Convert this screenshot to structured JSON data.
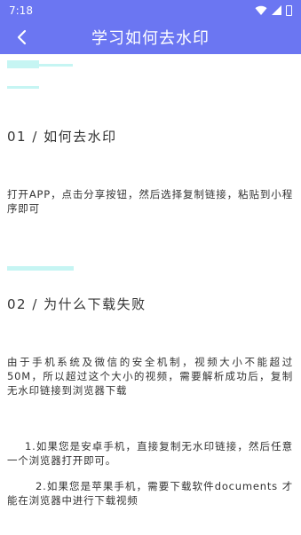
{
  "status_bar": {
    "time": "7:18"
  },
  "header": {
    "title": "学习如何去水印"
  },
  "sections": [
    {
      "heading": "01 /  如何去水印",
      "body": "打开APP，点击分享按钮，然后选择复制链接，粘贴到小程序即可"
    },
    {
      "heading": "02 /  为什么下载失败",
      "body": "由于手机系统及微信的安全机制，视频大小不能超过50M，所以超过这个大小的视频，需要解析成功后，复制无水印链接到浏览器下载",
      "tips": [
        "1.如果您是安卓手机，直接复制无水印链接，然后任意一个浏览器打开即可。",
        "2.如果您是苹果手机，需要下载软件documents 才能在浏览器中进行下载视频"
      ]
    }
  ],
  "colors": {
    "accent": "#6b76f2",
    "decor": "#c6f5f3"
  }
}
